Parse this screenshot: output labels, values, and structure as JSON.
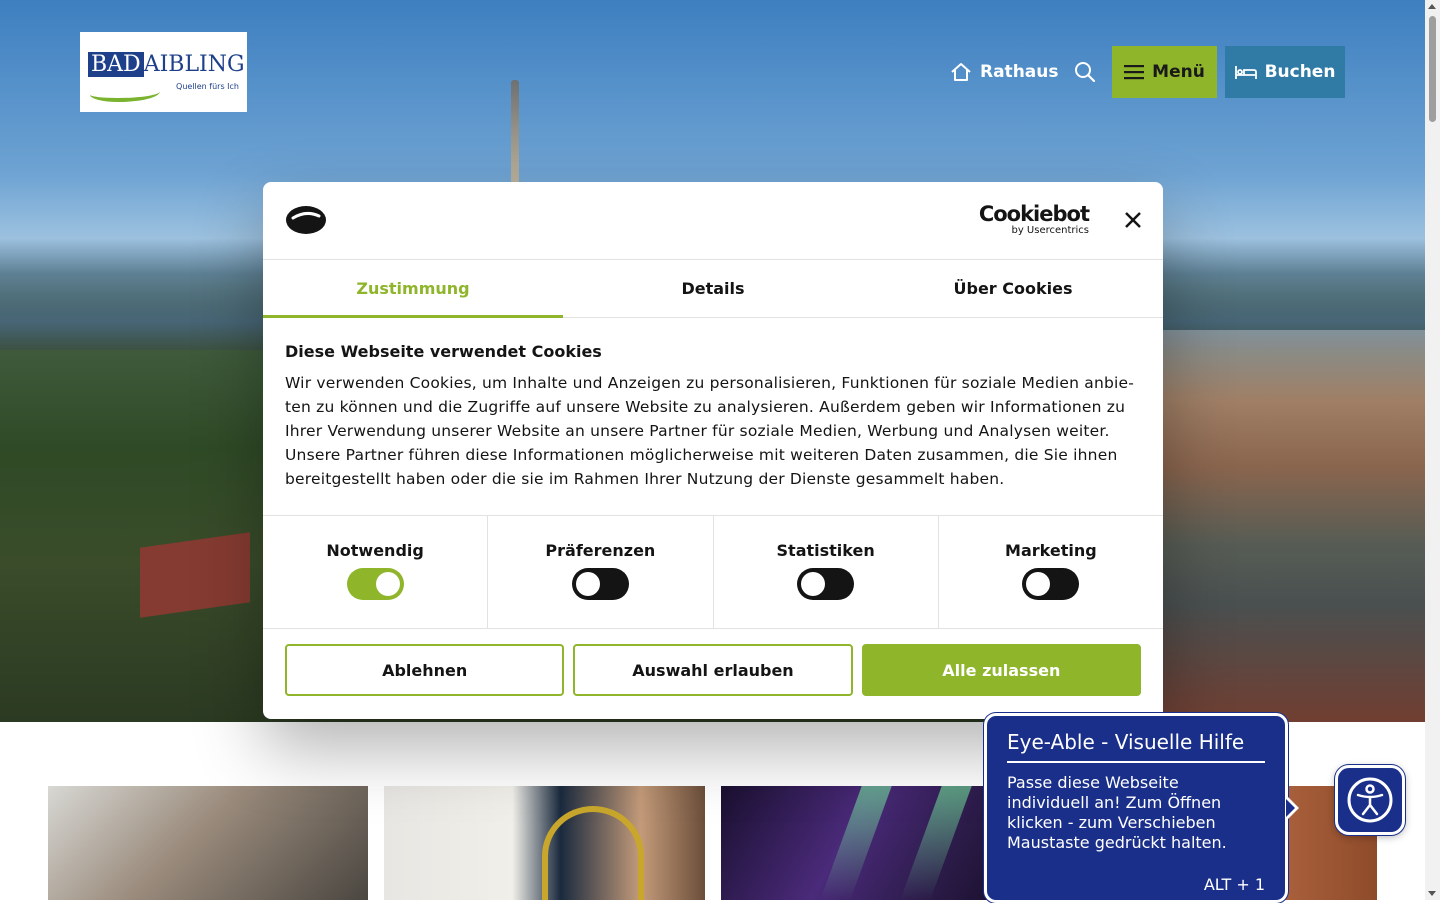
{
  "header": {
    "logo": {
      "word_bad": "BAD",
      "word_aibling": "AIBLING",
      "tagline": "Quellen fürs Ich"
    },
    "nav": {
      "rathaus": "Rathaus",
      "menu": "Menü",
      "book": "Buchen"
    }
  },
  "cookie_dialog": {
    "brand_name": "Cookiebot",
    "brand_sub": "by Usercentrics",
    "tabs": [
      {
        "label": "Zustimmung",
        "active": true
      },
      {
        "label": "Details",
        "active": false
      },
      {
        "label": "Über Cookies",
        "active": false
      }
    ],
    "heading": "Diese Webseite verwendet Cookies",
    "text": "Wir verwenden Cookies, um Inhalte und Anzeigen zu personalisieren, Funktionen für soziale Medien anbie­ten zu können und die Zugriffe auf unsere Website zu analysieren. Außerdem geben wir Informationen zu Ihrer Verwendung unserer Website an unsere Partner für soziale Medien, Werbung und Analysen weiter. Unsere Partner führen diese Informationen möglicherweise mit weiteren Daten zusammen, die Sie ihnen bereitgestellt haben oder die sie im Rahmen Ihrer Nutzung der Dienste gesammelt haben.",
    "toggles": [
      {
        "label": "Notwendig",
        "on": true
      },
      {
        "label": "Präferenzen",
        "on": false
      },
      {
        "label": "Statistiken",
        "on": false
      },
      {
        "label": "Marketing",
        "on": false
      }
    ],
    "buttons": {
      "decline": "Ablehnen",
      "allow_selection": "Auswahl erlauben",
      "allow_all": "Alle zulassen"
    }
  },
  "eye_able": {
    "title": "Eye-Able - Visuelle Hilfe",
    "body": "Passe diese Webseite individuell an! Zum Öffnen klicken - zum Verschieben Maustaste gedrückt halten.",
    "shortcut": "ALT + 1"
  },
  "colors": {
    "accent_green": "#8fb52a",
    "book_blue": "#2f7ba6",
    "eye_able_blue": "#1a2f8a",
    "brand_blue": "#1e3f8a"
  },
  "icons": [
    "home-icon",
    "search-icon",
    "hamburger-icon",
    "bed-icon",
    "cookiebot-icon",
    "close-icon",
    "accessibility-icon"
  ]
}
